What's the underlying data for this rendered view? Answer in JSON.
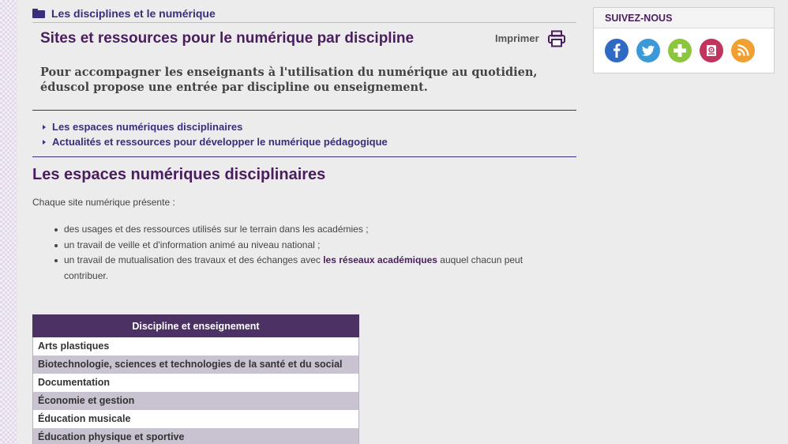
{
  "breadcrumb": {
    "label": "Les disciplines et le numérique",
    "icon": "folder-icon"
  },
  "page": {
    "title": "Sites et ressources pour le numérique par discipline",
    "print_label": "Imprimer",
    "intro": "Pour accompagner les enseignants à l'utilisation du numérique au quotidien, éduscol propose une entrée par discipline ou enseignement."
  },
  "toc": [
    {
      "label": "Les espaces numériques disciplinaires"
    },
    {
      "label": "Actualités et ressources pour développer le numérique pédagogique"
    }
  ],
  "section": {
    "title": "Les espaces numériques disciplinaires",
    "intro": "Chaque site numérique présente :",
    "bullets": [
      {
        "text": "des usages et des ressources utilisés sur le terrain dans les académies ;"
      },
      {
        "text": "un travail de veille et d'information animé au niveau national ;"
      },
      {
        "before": "un travail de mutualisation des travaux et des échanges avec ",
        "link": "les réseaux académiques",
        "after": " auquel chacun peut contribuer."
      }
    ]
  },
  "table": {
    "header": "Discipline et enseignement",
    "rows": [
      "Arts plastiques",
      "Biotechnologie, sciences et technologies de la santé et du social",
      "Documentation",
      "Économie et gestion",
      "Éducation musicale",
      "Éducation physique et sportive"
    ]
  },
  "sidebar": {
    "title": "SUIVEZ-NOUS",
    "social": [
      {
        "name": "facebook-icon",
        "color": "#2f6bc2"
      },
      {
        "name": "twitter-icon",
        "color": "#3a9ad9"
      },
      {
        "name": "plus-icon",
        "color": "#8cc63f"
      },
      {
        "name": "newsletter-icon",
        "color": "#c1345b"
      },
      {
        "name": "rss-icon",
        "color": "#f0a030"
      }
    ]
  },
  "colors": {
    "accent": "#3a2d7d",
    "title": "#4a1e5e",
    "table_header": "#4c3165",
    "table_alt_row": "#c9c2d1"
  }
}
